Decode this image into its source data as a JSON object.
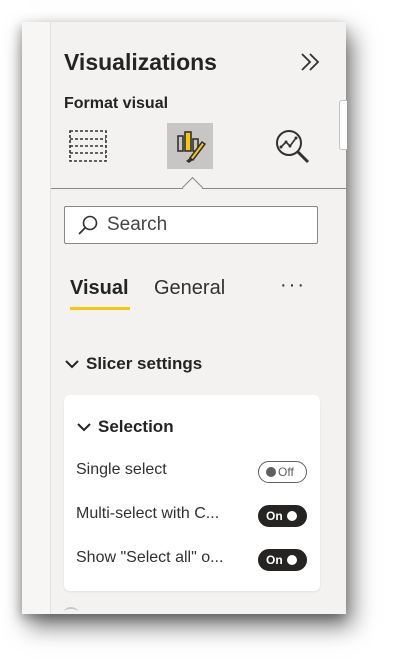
{
  "panel": {
    "title": "Visualizations",
    "subtitle": "Format visual",
    "search_placeholder": "Search",
    "viz_icons": [
      {
        "name": "table-build-icon",
        "active": false
      },
      {
        "name": "format-paintbrush-icon",
        "active": true
      },
      {
        "name": "analytics-magnifier-icon",
        "active": false
      }
    ],
    "tabs": [
      {
        "label": "Visual",
        "active": true
      },
      {
        "label": "General",
        "active": false
      }
    ],
    "more_label": "···",
    "section": {
      "label": "Slicer settings",
      "card": {
        "label": "Selection",
        "rows": [
          {
            "label": "Single select",
            "toggle": "Off",
            "state": false
          },
          {
            "label": "Multi-select with C...",
            "toggle": "On",
            "state": true
          },
          {
            "label": "Show \"Select all\" o...",
            "toggle": "On",
            "state": true
          }
        ]
      }
    }
  },
  "colors": {
    "accent": "#f2c811",
    "panel_bg": "#f3f2f1",
    "toggle_on": "#252423"
  }
}
